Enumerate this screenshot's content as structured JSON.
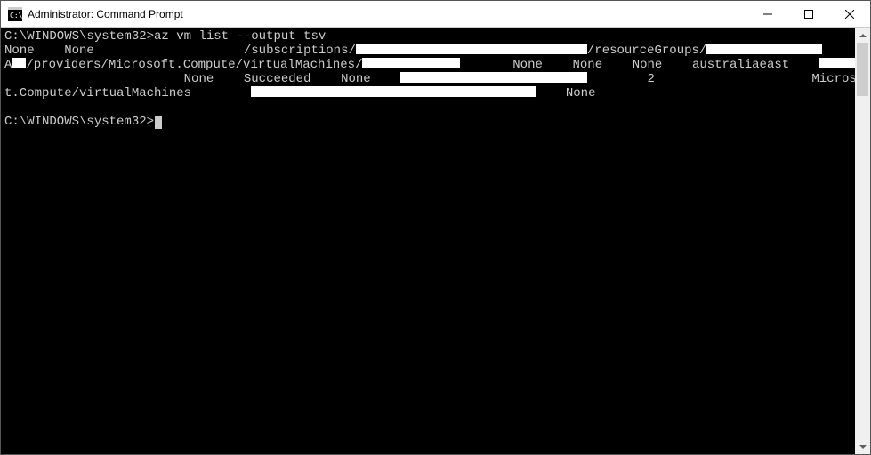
{
  "window": {
    "title": "Administrator: Command Prompt"
  },
  "console": {
    "prompt1": "C:\\WINDOWS\\system32>",
    "command": "az vm list --output tsv",
    "out": {
      "none": "None",
      "subscriptions": "/subscriptions/",
      "resourceGroups": "/resourceGroups/",
      "line2prefix": "A",
      "providersPath": "/providers/Microsoft.Compute/virtualMachines/",
      "location": "australiaeast",
      "succeeded": "Succeeded",
      "two": "2",
      "microsof": "Microsof",
      "tcompute": "t.Compute/virtualMachines"
    },
    "prompt2": "C:\\WINDOWS\\system32>"
  }
}
